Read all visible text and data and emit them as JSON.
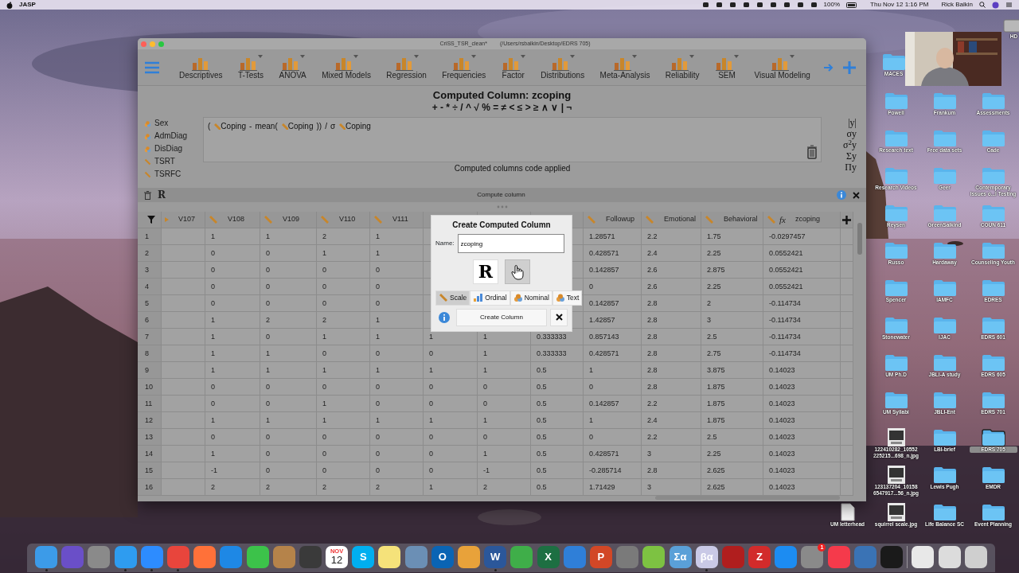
{
  "menu_bar": {
    "app": "JASP",
    "battery": "100%",
    "clock": "Thu Nov 12  1:16 PM",
    "user": "Rick Balkin"
  },
  "window": {
    "title": "CriSS_TSR_clean*",
    "path": "(/Users/rsbalkin/Desktop/EDRS 705)"
  },
  "toolbar": {
    "modules": [
      {
        "label": "Descriptives",
        "dropdown": false
      },
      {
        "label": "T-Tests",
        "dropdown": true
      },
      {
        "label": "ANOVA",
        "dropdown": true
      },
      {
        "label": "Mixed Models",
        "dropdown": true
      },
      {
        "label": "Regression",
        "dropdown": true
      },
      {
        "label": "Frequencies",
        "dropdown": true
      },
      {
        "label": "Factor",
        "dropdown": true
      },
      {
        "label": "Distributions",
        "dropdown": true
      },
      {
        "label": "Meta-Analysis",
        "dropdown": true
      },
      {
        "label": "Reliability",
        "dropdown": true
      },
      {
        "label": "SEM",
        "dropdown": true
      },
      {
        "label": "Visual Modeling",
        "dropdown": true
      }
    ]
  },
  "computed_panel": {
    "title": "Computed Column: zcoping",
    "operators": "+ - * ÷ / ^ √ % = ≠ < ≤ > ≥ ∧ ∨ | ¬",
    "variables": [
      {
        "name": "Sex",
        "kind": "nominal"
      },
      {
        "name": "AdmDiag",
        "kind": "nominal"
      },
      {
        "name": "DisDiag",
        "kind": "nominal"
      },
      {
        "name": "TSRT",
        "kind": "scale"
      },
      {
        "name": "TSRFC",
        "kind": "scale"
      }
    ],
    "formula": [
      {
        "kind": "text",
        "text": "("
      },
      {
        "kind": "var",
        "text": "Coping"
      },
      {
        "kind": "text",
        "text": "-"
      },
      {
        "kind": "text",
        "text": "mean("
      },
      {
        "kind": "var",
        "text": "Coping"
      },
      {
        "kind": "text",
        "text": "))"
      },
      {
        "kind": "text",
        "text": "/"
      },
      {
        "kind": "text",
        "text": "σ"
      },
      {
        "kind": "var",
        "text": "Coping"
      }
    ],
    "status": "Computed columns code applied",
    "functions": [
      "|y|",
      "σy",
      "σ$^{2}$y",
      "Σy",
      "Πy"
    ],
    "footer_label": "Compute column",
    "r_label": "R"
  },
  "table": {
    "columns": [
      {
        "name": "V107",
        "kind": "marker"
      },
      {
        "name": "V108",
        "kind": "scale"
      },
      {
        "name": "V109",
        "kind": "scale"
      },
      {
        "name": "V110",
        "kind": "scale"
      },
      {
        "name": "V111",
        "kind": "scale"
      },
      {
        "kind": "hidden"
      },
      {
        "kind": "hidden"
      },
      {
        "kind": "hidden"
      },
      {
        "name": "Followup",
        "kind": "scale"
      },
      {
        "name": "Emotional",
        "kind": "scale"
      },
      {
        "name": "Behavioral",
        "kind": "scale"
      },
      {
        "name": "zcoping",
        "kind": "computed",
        "mark": "fx"
      }
    ],
    "rows": [
      {
        "n": "1",
        "cells": [
          null,
          "1",
          "1",
          "2",
          "1",
          null,
          null,
          null,
          "1.28571",
          "2.2",
          "1.75",
          "-0.0297457"
        ]
      },
      {
        "n": "2",
        "cells": [
          null,
          "0",
          "0",
          "1",
          "1",
          null,
          null,
          null,
          "0.428571",
          "2.4",
          "2.25",
          "0.0552421"
        ]
      },
      {
        "n": "3",
        "cells": [
          null,
          "0",
          "0",
          "0",
          "0",
          null,
          null,
          null,
          "0.142857",
          "2.6",
          "2.875",
          "0.0552421"
        ]
      },
      {
        "n": "4",
        "cells": [
          null,
          "0",
          "0",
          "0",
          "0",
          null,
          null,
          null,
          "0",
          "2.6",
          "2.25",
          "0.0552421"
        ]
      },
      {
        "n": "5",
        "cells": [
          null,
          "0",
          "0",
          "0",
          "0",
          null,
          null,
          null,
          "0.142857",
          "2.8",
          "2",
          "-0.114734"
        ]
      },
      {
        "n": "6",
        "cells": [
          null,
          "1",
          "2",
          "2",
          "1",
          null,
          null,
          null,
          "1.42857",
          "2.8",
          "3",
          "-0.114734"
        ]
      },
      {
        "n": "7",
        "cells": [
          null,
          "1",
          "0",
          "1",
          "1",
          "1",
          "1",
          "0.333333",
          "0.857143",
          "2.8",
          "2.5",
          "-0.114734"
        ]
      },
      {
        "n": "8",
        "cells": [
          null,
          "1",
          "1",
          "0",
          "0",
          "0",
          "1",
          "0.333333",
          "0.428571",
          "2.8",
          "2.75",
          "-0.114734"
        ]
      },
      {
        "n": "9",
        "cells": [
          null,
          "1",
          "1",
          "1",
          "1",
          "1",
          "1",
          "0.5",
          "1",
          "2.8",
          "3.875",
          "0.14023"
        ]
      },
      {
        "n": "10",
        "cells": [
          null,
          "0",
          "0",
          "0",
          "0",
          "0",
          "0",
          "0.5",
          "0",
          "2.8",
          "1.875",
          "0.14023"
        ]
      },
      {
        "n": "11",
        "cells": [
          null,
          "0",
          "0",
          "1",
          "0",
          "0",
          "0",
          "0.5",
          "0.142857",
          "2.2",
          "1.875",
          "0.14023"
        ]
      },
      {
        "n": "12",
        "cells": [
          null,
          "1",
          "1",
          "1",
          "1",
          "1",
          "1",
          "0.5",
          "1",
          "2.4",
          "1.875",
          "0.14023"
        ]
      },
      {
        "n": "13",
        "cells": [
          null,
          "0",
          "0",
          "0",
          "0",
          "0",
          "0",
          "0.5",
          "0",
          "2.2",
          "2.5",
          "0.14023"
        ]
      },
      {
        "n": "14",
        "cells": [
          null,
          "1",
          "0",
          "0",
          "0",
          "0",
          "1",
          "0.5",
          "0.428571",
          "3",
          "2.25",
          "0.14023"
        ]
      },
      {
        "n": "15",
        "cells": [
          null,
          "-1",
          "0",
          "0",
          "0",
          "0",
          "-1",
          "0.5",
          "-0.285714",
          "2.8",
          "2.625",
          "0.14023"
        ]
      },
      {
        "n": "16",
        "cells": [
          null,
          "2",
          "2",
          "2",
          "2",
          "1",
          "2",
          "0.5",
          "1.71429",
          "3",
          "2.625",
          "0.14023"
        ]
      }
    ]
  },
  "dialog": {
    "title": "Create Computed Column",
    "name_label": "Name:",
    "name_value": "zcoping",
    "modes": [
      {
        "kind": "r",
        "label": "R",
        "selected": false
      },
      {
        "kind": "hand",
        "selected": true
      }
    ],
    "types": [
      {
        "label": "Scale",
        "kind": "scale",
        "selected": true
      },
      {
        "label": "Ordinal",
        "kind": "ordinal",
        "selected": false
      },
      {
        "label": "Nominal",
        "kind": "nominal",
        "selected": false
      },
      {
        "label": "Text",
        "kind": "text",
        "selected": false
      }
    ],
    "create_button": "Create Column"
  },
  "desktop": {
    "icons": [
      {
        "label": "Powell",
        "kind": "folder",
        "selected": false
      },
      {
        "label": "Frankum",
        "kind": "folder",
        "selected": false
      },
      {
        "label": "Assessments",
        "kind": "folder",
        "selected": false
      },
      {
        "label": "Research text",
        "kind": "folder",
        "selected": false
      },
      {
        "label": "Free data sets",
        "kind": "folder",
        "selected": false
      },
      {
        "label": "Cade",
        "kind": "folder",
        "selected": false
      },
      {
        "label": "Research Videos",
        "kind": "folder",
        "selected": false
      },
      {
        "label": "Geer",
        "kind": "folder",
        "selected": false
      },
      {
        "label": "Contemporary Issues o...l Testing",
        "kind": "folder",
        "selected": false
      },
      {
        "label": "Reysen",
        "kind": "folder",
        "selected": false
      },
      {
        "label": "GreenSalkind",
        "kind": "folder",
        "selected": false
      },
      {
        "label": "COUN 611",
        "kind": "folder",
        "selected": false
      },
      {
        "label": "Russo",
        "kind": "folder",
        "selected": false
      },
      {
        "label": "Hardaway",
        "kind": "folder",
        "selected": false
      },
      {
        "label": "Counseling Youth",
        "kind": "folder",
        "selected": false
      },
      {
        "label": "Spencer",
        "kind": "folder",
        "selected": false
      },
      {
        "label": "IAMFC",
        "kind": "folder",
        "selected": false
      },
      {
        "label": "EDRES",
        "kind": "folder",
        "selected": false
      },
      {
        "label": "Stonewater",
        "kind": "folder",
        "selected": false
      },
      {
        "label": "IJAC",
        "kind": "folder",
        "selected": false
      },
      {
        "label": "EDRS 601",
        "kind": "folder",
        "selected": false
      },
      {
        "label": "UM Ph.D",
        "kind": "folder",
        "selected": false
      },
      {
        "label": "JBLI-A study",
        "kind": "folder",
        "selected": false
      },
      {
        "label": "EDRS 605",
        "kind": "folder",
        "selected": false
      },
      {
        "label": "UM Syllabi",
        "kind": "folder",
        "selected": false
      },
      {
        "label": "JBLI-Ent",
        "kind": "folder",
        "selected": false
      },
      {
        "label": "EDRS 701",
        "kind": "folder",
        "selected": false
      },
      {
        "label": "122410282_10552 225215...698_n.jpg",
        "selected": false
      },
      {
        "label": "LBI-brief",
        "kind": "folder",
        "selected": false
      },
      {
        "label": "EDRS 705",
        "kind": "folder",
        "selected": true
      },
      {
        "label": "123137204_10158 6547917...56_n.jpg",
        "selected": false
      },
      {
        "label": "Lewis Pugh",
        "kind": "folder",
        "selected": false
      },
      {
        "label": "EMDR",
        "kind": "folder",
        "selected": false
      },
      {
        "label": "squirrel scale.jpg",
        "selected": false
      },
      {
        "label": "Life Balance SC",
        "kind": "folder",
        "selected": false
      },
      {
        "label": "Event Planning",
        "kind": "folder",
        "selected": false
      }
    ],
    "extra_icons": [
      {
        "label": "MACES",
        "kind": "folder"
      },
      {
        "label": "UM letterhead",
        "kind": "document"
      },
      {
        "label": "HD",
        "kind": "drive"
      }
    ]
  },
  "dock": [
    {
      "kind": "app",
      "color": "#3c9be8",
      "running": true
    },
    {
      "kind": "app",
      "color": "#6a4fc8",
      "running": false
    },
    {
      "kind": "app",
      "color": "#8a8a8a",
      "running": false
    },
    {
      "kind": "app",
      "color": "#2e9cf0",
      "running": true
    },
    {
      "kind": "app",
      "color": "#2d8cff",
      "running": true
    },
    {
      "kind": "app",
      "color": "#e8453c",
      "running": true
    },
    {
      "kind": "app",
      "color": "#ff7139",
      "running": false
    },
    {
      "kind": "app",
      "color": "#1e88e5",
      "running": false
    },
    {
      "kind": "app",
      "color": "#3cc24a",
      "running": false
    },
    {
      "kind": "app",
      "color": "#b5834a",
      "running": false
    },
    {
      "kind": "app",
      "color": "#3a3a3a",
      "running": false
    },
    {
      "kind": "calendar",
      "month": "NOV",
      "day": "12",
      "running": false
    },
    {
      "kind": "app",
      "color": "#00aff0",
      "glyph": "S",
      "running": false
    },
    {
      "kind": "app",
      "color": "#f5e27a",
      "running": false
    },
    {
      "kind": "app",
      "color": "#6b8fb5",
      "running": false
    },
    {
      "kind": "app",
      "color": "#0a64b4",
      "glyph": "O",
      "running": false
    },
    {
      "kind": "app",
      "color": "#e8a23a",
      "running": false
    },
    {
      "kind": "app",
      "color": "#2b579a",
      "glyph": "W",
      "running": true
    },
    {
      "kind": "app",
      "color": "#3fae49",
      "running": false
    },
    {
      "kind": "app",
      "color": "#1d6f42",
      "glyph": "X",
      "running": false
    },
    {
      "kind": "app",
      "color": "#2f7fd8",
      "running": false
    },
    {
      "kind": "app",
      "color": "#d24726",
      "glyph": "P",
      "running": false
    },
    {
      "kind": "app",
      "color": "#7a7a7a",
      "running": false
    },
    {
      "kind": "app",
      "color": "#7dc242",
      "running": false
    },
    {
      "kind": "app",
      "color": "#5aa0d8",
      "glyph": "Σα",
      "running": false
    },
    {
      "kind": "app",
      "color": "#c9c9e6",
      "glyph": "βα",
      "running": true
    },
    {
      "kind": "app",
      "color": "#b01e1e",
      "running": false
    },
    {
      "kind": "app",
      "color": "#d22b2b",
      "glyph": "Z",
      "running": false
    },
    {
      "kind": "app",
      "color": "#1c8cf2",
      "running": false
    },
    {
      "kind": "app",
      "color": "#8a8a8a",
      "badge": "1",
      "running": false
    },
    {
      "kind": "app",
      "color": "#f53a4b",
      "running": false
    },
    {
      "kind": "app",
      "color": "#3a73b5",
      "running": false
    },
    {
      "kind": "app",
      "color": "#1a1a1a",
      "running": false
    },
    {
      "kind": "divider"
    },
    {
      "kind": "app",
      "color": "#e8e8e8",
      "running": false
    },
    {
      "kind": "app",
      "color": "#dcdcdc",
      "running": false
    },
    {
      "kind": "app",
      "color": "#cfcfcf",
      "running": false
    }
  ]
}
